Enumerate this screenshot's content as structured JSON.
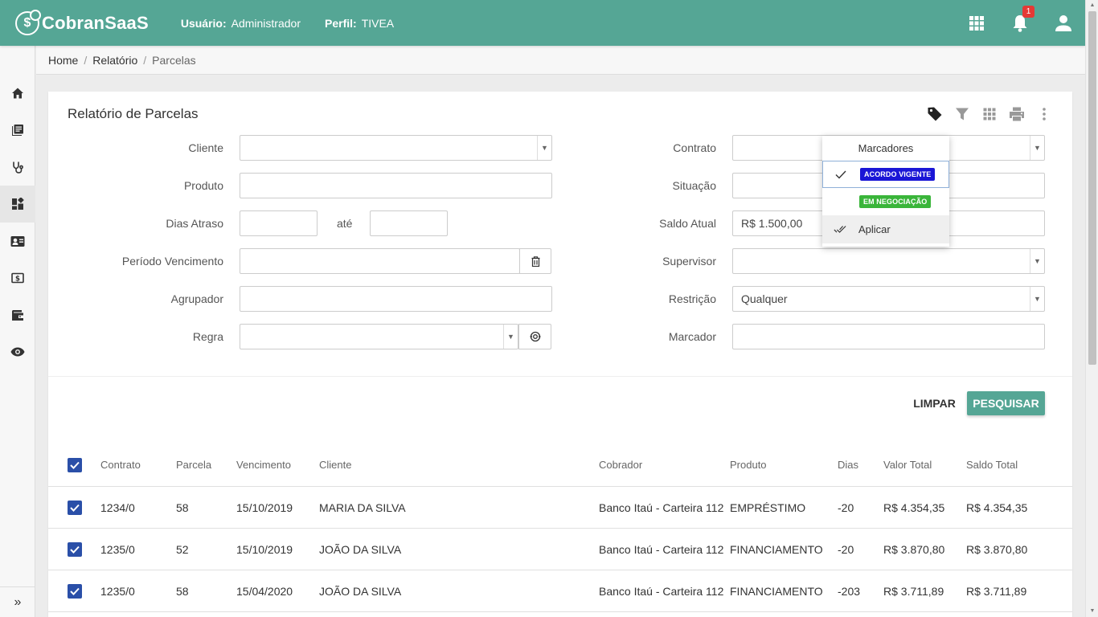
{
  "header": {
    "logo_glyph": "$",
    "app_name": "CobranSaaS",
    "user_label": "Usuário:",
    "user_value": "Administrador",
    "profile_label": "Perfil:",
    "profile_value": "TIVEA",
    "notification_count": "1",
    "accent_color": "#55a695"
  },
  "sidebar": {
    "items": [
      "home-icon",
      "book-icon",
      "stethoscope-icon",
      "dashboard-icon",
      "contact-card-icon",
      "money-icon",
      "wallet-icon",
      "eye-icon"
    ],
    "expand_label": "»"
  },
  "breadcrumb": {
    "items": [
      "Home",
      "Relatório",
      "Parcelas"
    ],
    "separator": "/"
  },
  "card": {
    "title": "Relatório de Parcelas"
  },
  "form": {
    "cliente_label": "Cliente",
    "produto_label": "Produto",
    "dias_atraso_label": "Dias Atraso",
    "ate_label": "até",
    "periodo_label": "Período Vencimento",
    "agrupador_label": "Agrupador",
    "regra_label": "Regra",
    "contrato_label": "Contrato",
    "situacao_label": "Situação",
    "saldo_label": "Saldo Atual",
    "saldo_value": "R$ 1.500,00",
    "supervisor_label": "Supervisor",
    "restricao_label": "Restrição",
    "restricao_value": "Qualquer",
    "marcador_label": "Marcador"
  },
  "actions": {
    "limpar": "LIMPAR",
    "pesquisar": "PESQUISAR"
  },
  "marcadores_popup": {
    "title": "Marcadores",
    "tags": [
      {
        "label": "ACORDO VIGENTE",
        "color": "#1a16d6",
        "checked": true
      },
      {
        "label": "EM NEGOCIAÇÃO",
        "color": "#3ab53a",
        "checked": false
      }
    ],
    "apply_label": "Aplicar"
  },
  "table": {
    "headers": [
      "Contrato",
      "Parcela",
      "Vencimento",
      "Cliente",
      "Cobrador",
      "Produto",
      "Dias",
      "Valor Total",
      "Saldo Total"
    ],
    "rows": [
      [
        "1234/0",
        "58",
        "15/10/2019",
        "MARIA DA SILVA",
        "Banco Itaú - Carteira 112",
        "EMPRÉSTIMO",
        "-20",
        "R$ 4.354,35",
        "R$ 4.354,35"
      ],
      [
        "1235/0",
        "52",
        "15/10/2019",
        "JOÃO DA SILVA",
        "Banco Itaú - Carteira 112",
        "FINANCIAMENTO",
        "-20",
        "R$ 3.870,80",
        "R$ 3.870,80"
      ],
      [
        "1235/0",
        "58",
        "15/04/2020",
        "JOÃO DA SILVA",
        "Banco Itaú - Carteira 112",
        "FINANCIAMENTO",
        "-203",
        "R$ 3.711,89",
        "R$ 3.711,89"
      ]
    ]
  }
}
